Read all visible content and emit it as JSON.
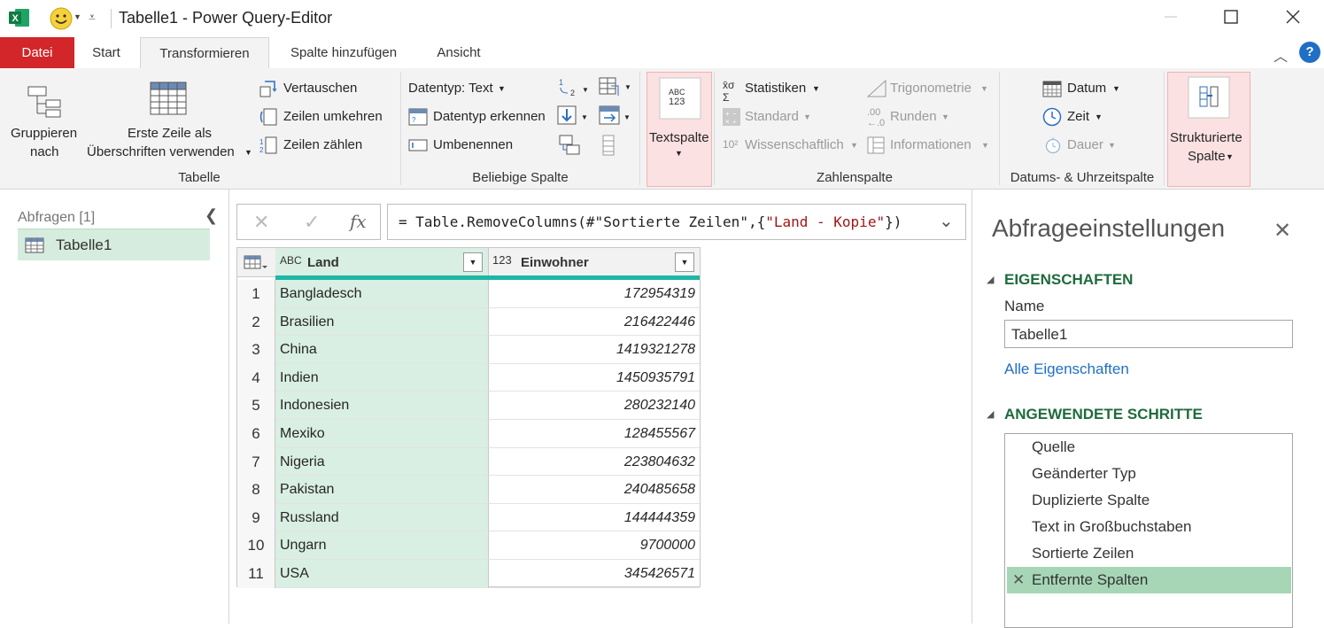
{
  "titlebar": {
    "title": "Tabelle1 - Power Query-Editor",
    "minimize_icon": "minimize-icon",
    "maximize_icon": "maximize-icon",
    "close_icon": "close-icon"
  },
  "tabs": [
    {
      "label": "Datei"
    },
    {
      "label": "Start"
    },
    {
      "label": "Transformieren"
    },
    {
      "label": "Spalte hinzufügen"
    },
    {
      "label": "Ansicht"
    }
  ],
  "ribbon": {
    "gruppieren": "Gruppieren nach",
    "gruppieren_l1": "Gruppieren",
    "gruppieren_l2": "nach",
    "erste_zeile_l1": "Erste Zeile als",
    "erste_zeile_l2": "Überschriften verwenden",
    "vertauschen": "Vertauschen",
    "zeilen_umkehren": "Zeilen umkehren",
    "zeilen_zaehlen": "Zeilen zählen",
    "group_tabelle": "Tabelle",
    "datentyp": "Datentyp: Text",
    "datentyp_erkennen": "Datentyp erkennen",
    "umbenennen": "Umbenennen",
    "group_beliebige": "Beliebige Spalte",
    "textspalte": "Textspalte",
    "statistiken": "Statistiken",
    "standard": "Standard",
    "wissenschaftlich": "Wissenschaftlich",
    "trigonometrie": "Trigonometrie",
    "runden": "Runden",
    "informationen": "Informationen",
    "group_zahlen": "Zahlenspalte",
    "datum": "Datum",
    "zeit": "Zeit",
    "dauer": "Dauer",
    "group_datum": "Datums- & Uhrzeitspalte",
    "strukt_l1": "Strukturierte",
    "strukt_l2": "Spalte"
  },
  "leftpane": {
    "header": "Abfragen [1]",
    "query": "Tabelle1"
  },
  "formula": {
    "prefix": "= Table.RemoveColumns(#\"Sortierte Zeilen\",{",
    "string": "\"Land - Kopie\"",
    "suffix": "})"
  },
  "grid": {
    "col1_type": "ABC",
    "col1": "Land",
    "col2_type": "123",
    "col2": "Einwohner",
    "rows": [
      {
        "n": "1",
        "land": "Bangladesch",
        "ew": "172954319"
      },
      {
        "n": "2",
        "land": "Brasilien",
        "ew": "216422446"
      },
      {
        "n": "3",
        "land": "China",
        "ew": "1419321278"
      },
      {
        "n": "4",
        "land": "Indien",
        "ew": "1450935791"
      },
      {
        "n": "5",
        "land": "Indonesien",
        "ew": "280232140"
      },
      {
        "n": "6",
        "land": "Mexiko",
        "ew": "128455567"
      },
      {
        "n": "7",
        "land": "Nigeria",
        "ew": "223804632"
      },
      {
        "n": "8",
        "land": "Pakistan",
        "ew": "240485658"
      },
      {
        "n": "9",
        "land": "Russland",
        "ew": "144444359"
      },
      {
        "n": "10",
        "land": "Ungarn",
        "ew": "9700000"
      },
      {
        "n": "11",
        "land": "USA",
        "ew": "345426571"
      }
    ]
  },
  "rightpane": {
    "title": "Abfrageeinstellungen",
    "eigenschaften": "EIGENSCHAFTEN",
    "name_label": "Name",
    "name_value": "Tabelle1",
    "alle": "Alle Eigenschaften",
    "schritte": "ANGEWENDETE SCHRITTE",
    "steps": [
      "Quelle",
      "Geänderter Typ",
      "Duplizierte Spalte",
      "Text in Großbuchstaben",
      "Sortierte Zeilen",
      "Entfernte Spalten"
    ]
  },
  "colors": {
    "accent_green": "#1e6b3c",
    "file_tab": "#d2262a",
    "selected_column": "#d9efe3",
    "selected_step": "#a6d6b6",
    "teal_bar": "#1fb6a8"
  }
}
